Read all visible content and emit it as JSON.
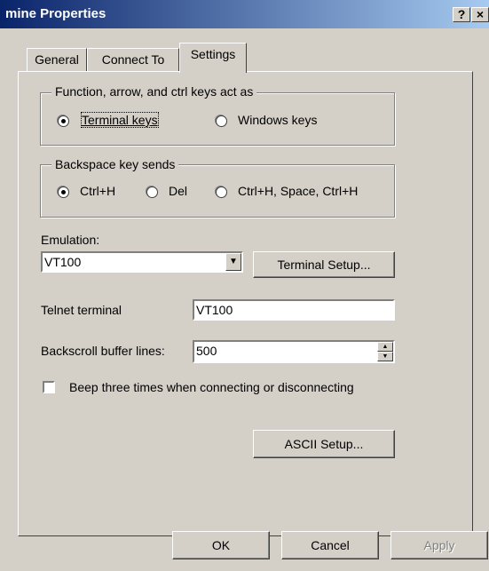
{
  "window": {
    "title": "mine Properties",
    "help_label": "?",
    "close_label": "×"
  },
  "tabs": [
    {
      "label": "General"
    },
    {
      "label": "Connect To"
    },
    {
      "label": "Settings"
    }
  ],
  "keys_group": {
    "legend": "Function, arrow, and ctrl keys act as",
    "selected": "Terminal keys",
    "options": [
      {
        "label": "Terminal keys"
      },
      {
        "label": "Windows keys"
      }
    ]
  },
  "backspace_group": {
    "legend": "Backspace key sends",
    "selected": "Ctrl+H",
    "options": [
      {
        "label": "Ctrl+H"
      },
      {
        "label": "Del"
      },
      {
        "label": "Ctrl+H, Space, Ctrl+H"
      }
    ]
  },
  "emulation": {
    "label": "Emulation:",
    "value": "VT100",
    "setup_button": "Terminal Setup..."
  },
  "telnet": {
    "label": "Telnet terminal",
    "value": "VT100"
  },
  "backscroll": {
    "label": "Backscroll buffer lines:",
    "value": "500"
  },
  "beep": {
    "label": "Beep three times when connecting or disconnecting",
    "checked": false
  },
  "ascii_button": "ASCII Setup...",
  "footer": {
    "ok": "OK",
    "cancel": "Cancel",
    "apply": "Apply"
  }
}
